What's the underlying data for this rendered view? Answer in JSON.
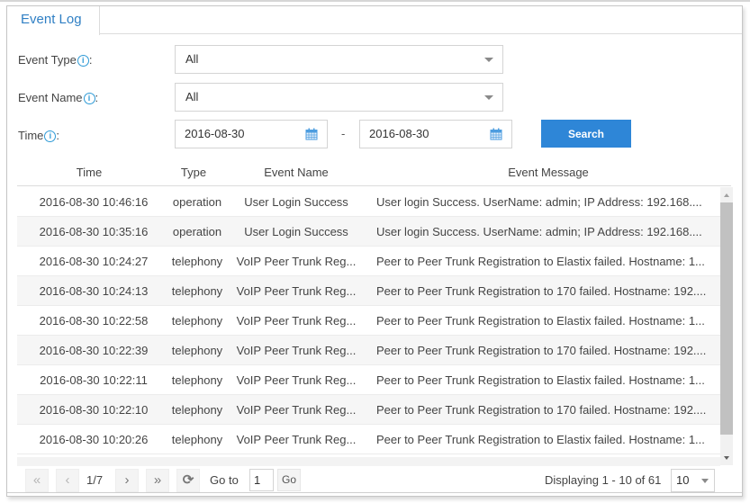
{
  "tab": {
    "label": "Event Log"
  },
  "filters": {
    "event_type": {
      "label": "Event Type",
      "suffix": ":",
      "value": "All"
    },
    "event_name": {
      "label": "Event Name",
      "suffix": ":",
      "value": "All"
    },
    "time": {
      "label": "Time",
      "suffix": ":",
      "from": "2016-08-30",
      "separator": "-",
      "to": "2016-08-30"
    },
    "info_glyph": "i",
    "search_label": "Search"
  },
  "table": {
    "columns": [
      "Time",
      "Type",
      "Event Name",
      "Event Message"
    ],
    "rows": [
      {
        "time": "2016-08-30 10:46:16",
        "type": "operation",
        "name": "User Login Success",
        "message": "User login Success. UserName: admin; IP Address: 192.168...."
      },
      {
        "time": "2016-08-30 10:35:16",
        "type": "operation",
        "name": "User Login Success",
        "message": "User login Success. UserName: admin; IP Address: 192.168...."
      },
      {
        "time": "2016-08-30 10:24:27",
        "type": "telephony",
        "name": "VoIP Peer Trunk Reg...",
        "message": "Peer to Peer Trunk Registration to Elastix failed. Hostname: 1..."
      },
      {
        "time": "2016-08-30 10:24:13",
        "type": "telephony",
        "name": "VoIP Peer Trunk Reg...",
        "message": "Peer to Peer Trunk Registration to 170 failed. Hostname: 192...."
      },
      {
        "time": "2016-08-30 10:22:58",
        "type": "telephony",
        "name": "VoIP Peer Trunk Reg...",
        "message": "Peer to Peer Trunk Registration to Elastix failed. Hostname: 1..."
      },
      {
        "time": "2016-08-30 10:22:39",
        "type": "telephony",
        "name": "VoIP Peer Trunk Reg...",
        "message": "Peer to Peer Trunk Registration to 170 failed. Hostname: 192...."
      },
      {
        "time": "2016-08-30 10:22:11",
        "type": "telephony",
        "name": "VoIP Peer Trunk Reg...",
        "message": "Peer to Peer Trunk Registration to Elastix failed. Hostname: 1..."
      },
      {
        "time": "2016-08-30 10:22:10",
        "type": "telephony",
        "name": "VoIP Peer Trunk Reg...",
        "message": "Peer to Peer Trunk Registration to 170 failed. Hostname: 192...."
      },
      {
        "time": "2016-08-30 10:20:26",
        "type": "telephony",
        "name": "VoIP Peer Trunk Reg...",
        "message": "Peer to Peer Trunk Registration to Elastix failed. Hostname: 1..."
      }
    ]
  },
  "pagination": {
    "first_glyph": "«",
    "prev_glyph": "‹",
    "page_indicator": "1/7",
    "next_glyph": "›",
    "last_glyph": "»",
    "refresh_glyph": "⟳",
    "goto_label": "Go to",
    "goto_value": "1",
    "go_label": "Go",
    "display_text": "Displaying 1 - 10 of 61",
    "page_size": "10"
  },
  "colors": {
    "accent": "#2e86d7",
    "tab_text": "#2f7fc4",
    "info_icon": "#2e9ad6"
  }
}
